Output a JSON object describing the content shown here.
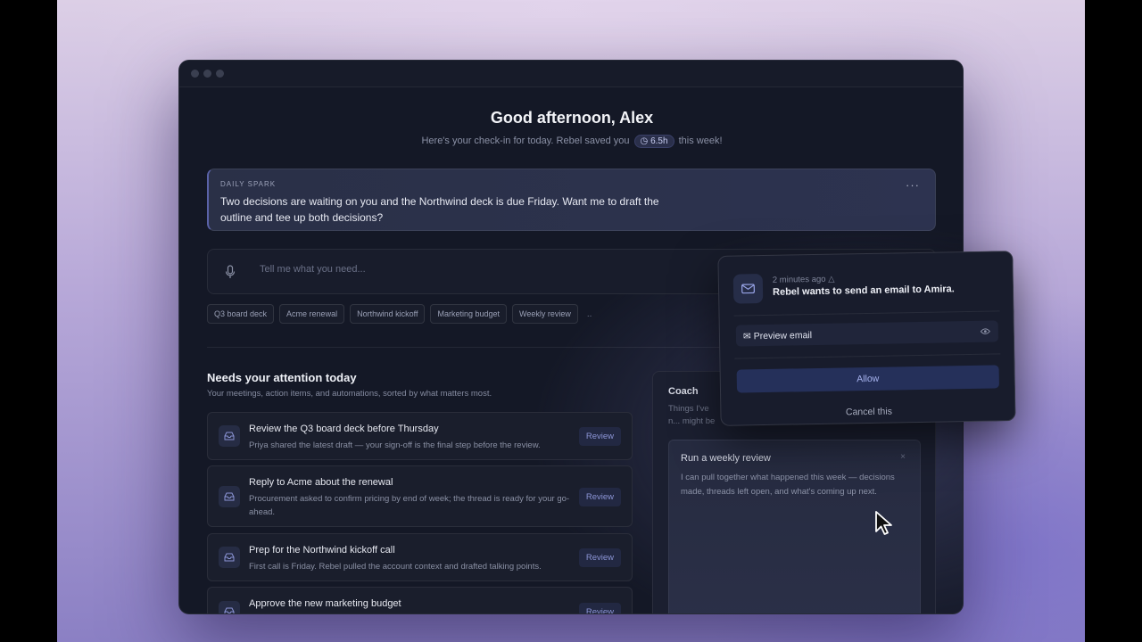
{
  "header": {
    "greeting": "Good afternoon, Alex",
    "subline_prefix": "Here's your check-in for today.  Rebel saved you",
    "saved_time": "6.5h",
    "subline_suffix": "this week!"
  },
  "spark": {
    "label": "DAILY SPARK",
    "text": "Two decisions are waiting on you and the Northwind deck is due Friday. Want me to draft the outline and tee up both decisions?",
    "more": "···"
  },
  "ask": {
    "placeholder": "Tell me what you need..."
  },
  "chips": [
    "Q3 board deck",
    "Acme renewal",
    "Northwind kickoff",
    "Marketing budget",
    "Weekly review"
  ],
  "chips_more": "..",
  "attention": {
    "title": "Needs your attention today",
    "subtitle": "Your meetings, action items, and automations, sorted by what matters most.",
    "items": [
      {
        "title": "Review the Q3 board deck before Thursday",
        "desc": "Priya shared the latest draft — your sign-off is the final step before the review.",
        "action": "Review"
      },
      {
        "title": "Reply to Acme about the renewal",
        "desc": "Procurement asked to confirm pricing by end of week; the thread is ready for your go-ahead.",
        "action": "Review"
      },
      {
        "title": "Prep for the Northwind kickoff call",
        "desc": "First call is Friday. Rebel pulled the account context and drafted talking points.",
        "action": "Review"
      },
      {
        "title": "Approve the new marketing budget",
        "desc": "",
        "action": "Review"
      }
    ]
  },
  "coach": {
    "title": "Coach",
    "subtitle": "Things I've n... might be wor...",
    "card_title": "Run a weekly review",
    "card_close": "×",
    "card_text": "I can pull together what happened this week — decisions made, threads left open, and what's coming up next."
  },
  "notification": {
    "time": "2 minutes ago",
    "title": "Rebel wants to send an email to Amira.",
    "preview_label": "Preview email",
    "allow_label": "Allow",
    "cancel_label": "Cancel this"
  }
}
